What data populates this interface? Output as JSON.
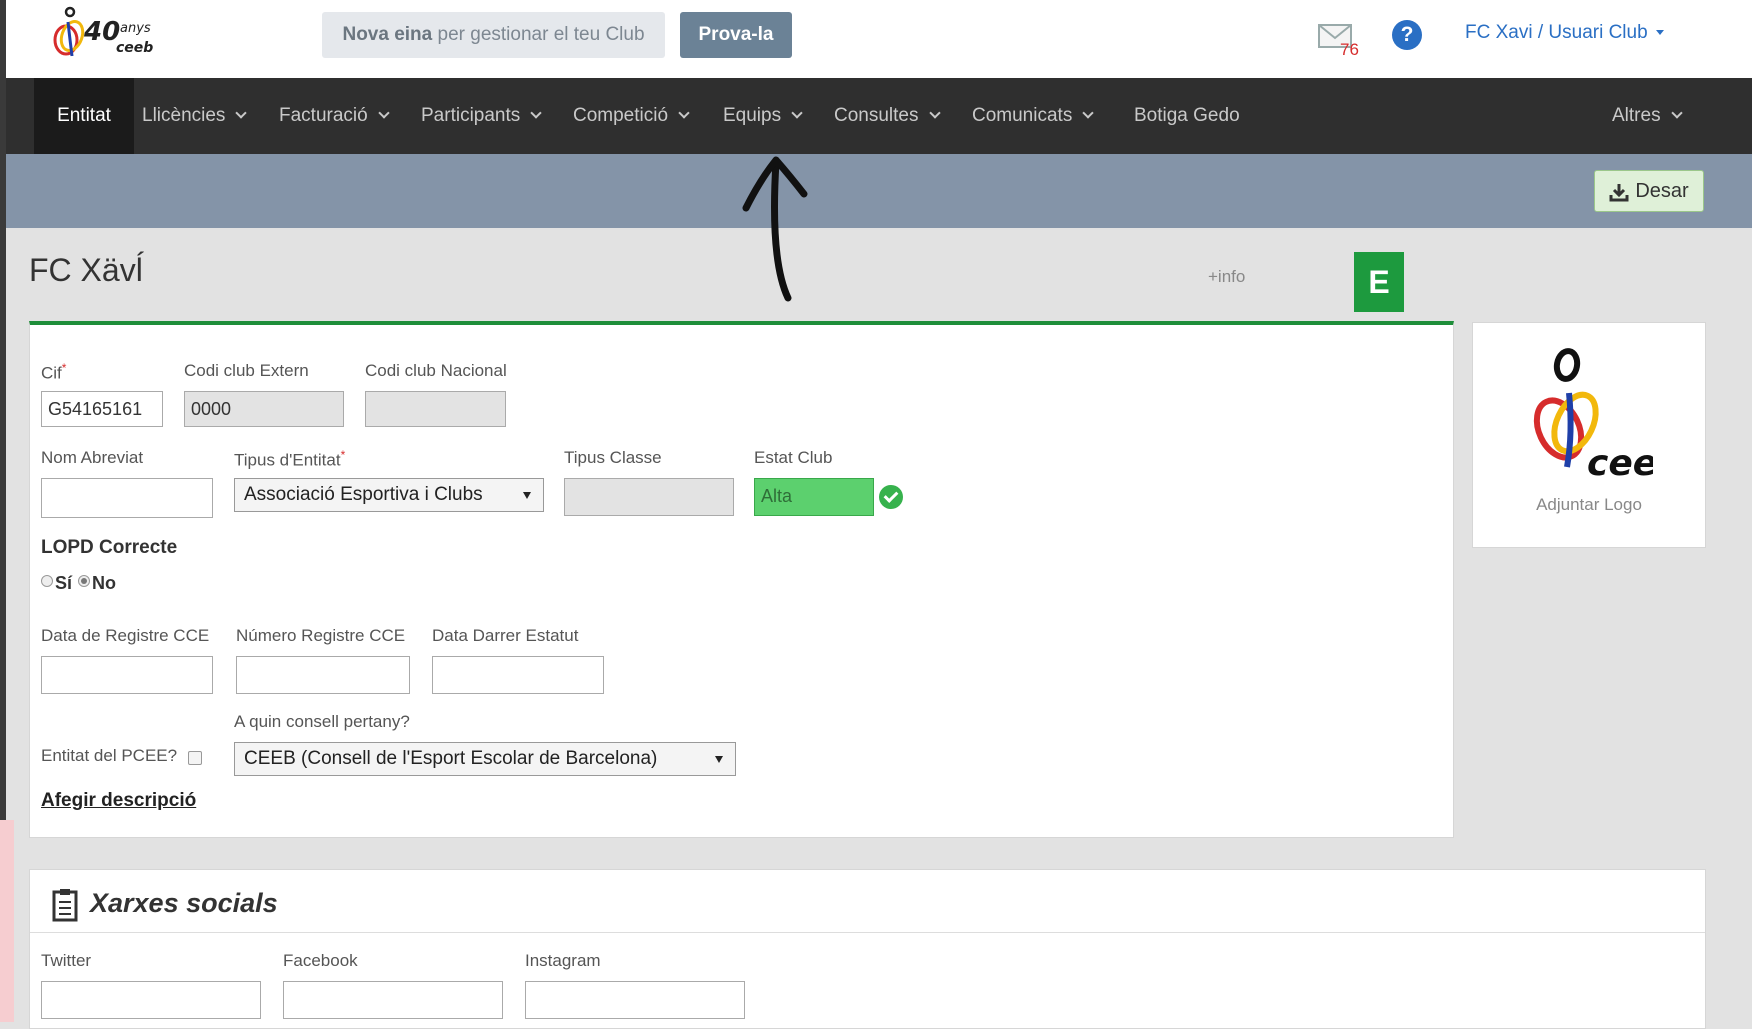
{
  "header": {
    "logo_text": "40anys ceeb",
    "promo_bold": "Nova eina",
    "promo_rest": " per gestionar el teu Club",
    "try_button": "Prova-la",
    "mail_count": "76",
    "help_glyph": "?",
    "user_menu": "FC Xavi / Usuari Club"
  },
  "nav": {
    "items": [
      {
        "label": "Entitat",
        "active": true
      },
      {
        "label": "Llicències"
      },
      {
        "label": "Facturació"
      },
      {
        "label": "Participants"
      },
      {
        "label": "Competició"
      },
      {
        "label": "Equips"
      },
      {
        "label": "Consultes"
      },
      {
        "label": "Comunicats"
      },
      {
        "label": "Botiga Gedo"
      },
      {
        "label": "Altres"
      }
    ]
  },
  "toolbar": {
    "save_label": "Desar"
  },
  "page": {
    "title": "FC Xävĺ",
    "info_link": "+info",
    "badge": "E"
  },
  "form": {
    "cif": {
      "label": "Cif",
      "value": "G54165161"
    },
    "codi_extern": {
      "label": "Codi club Extern",
      "value": "0000"
    },
    "codi_nacional": {
      "label": "Codi club Nacional",
      "value": ""
    },
    "nom_abreviat": {
      "label": "Nom Abreviat",
      "value": ""
    },
    "tipus_entitat": {
      "label": "Tipus d'Entitat",
      "value": "Associació Esportiva i Clubs"
    },
    "tipus_classe": {
      "label": "Tipus Classe",
      "value": ""
    },
    "estat_club": {
      "label": "Estat Club",
      "value": "Alta"
    },
    "lopd": {
      "label": "LOPD Correcte",
      "option_yes": "Sí",
      "option_no": "No",
      "selected": "No"
    },
    "data_registre": {
      "label": "Data de Registre CCE",
      "value": ""
    },
    "numero_registre": {
      "label": "Número Registre CCE",
      "value": ""
    },
    "data_estatut": {
      "label": "Data Darrer Estatut",
      "value": ""
    },
    "consell": {
      "label": "A quin consell pertany?",
      "value": "CEEB (Consell de l'Esport Escolar de Barcelona)"
    },
    "pcee": {
      "label": "Entitat del PCEE?",
      "checked": false
    },
    "add_description": "Afegir descripció"
  },
  "logo_card": {
    "logo_text": "ceeb",
    "attach_label": "Adjuntar Logo"
  },
  "social": {
    "title": "Xarxes socials",
    "fields": [
      {
        "label": "Twitter",
        "value": ""
      },
      {
        "label": "Facebook",
        "value": ""
      },
      {
        "label": "Instagram",
        "value": ""
      }
    ]
  },
  "colors": {
    "nav_bg": "#2f2f2f",
    "toolbar_bg": "#8494a8",
    "accent_green": "#1d9a3e",
    "link_blue": "#2a6fc4"
  }
}
